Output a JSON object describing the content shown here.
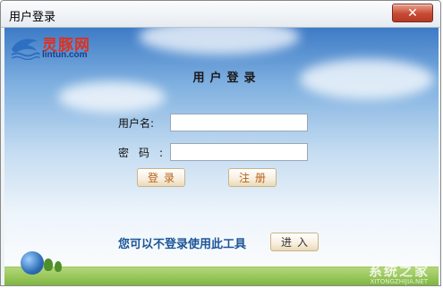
{
  "window": {
    "title": "用户登录",
    "close_glyph": "✕"
  },
  "logo": {
    "name": "灵豚网",
    "url": "lintun.com",
    "icon": "dolphin-icon"
  },
  "heading": "用户登录",
  "form": {
    "username_label": "用户名:",
    "password_label": "密码:",
    "username_value": "",
    "password_value": "",
    "login_button": "登录",
    "register_button": "注册"
  },
  "footer": {
    "hint": "您可以不登录使用此工具",
    "enter_button": "进入"
  },
  "watermark": {
    "text": "系统之家",
    "sub": "XITONGZHIJIA.NET"
  },
  "colors": {
    "accent_button_text": "#b8611a",
    "hint_text": "#1b5597",
    "logo_red": "#e0301e",
    "close_red": "#c74a33"
  }
}
